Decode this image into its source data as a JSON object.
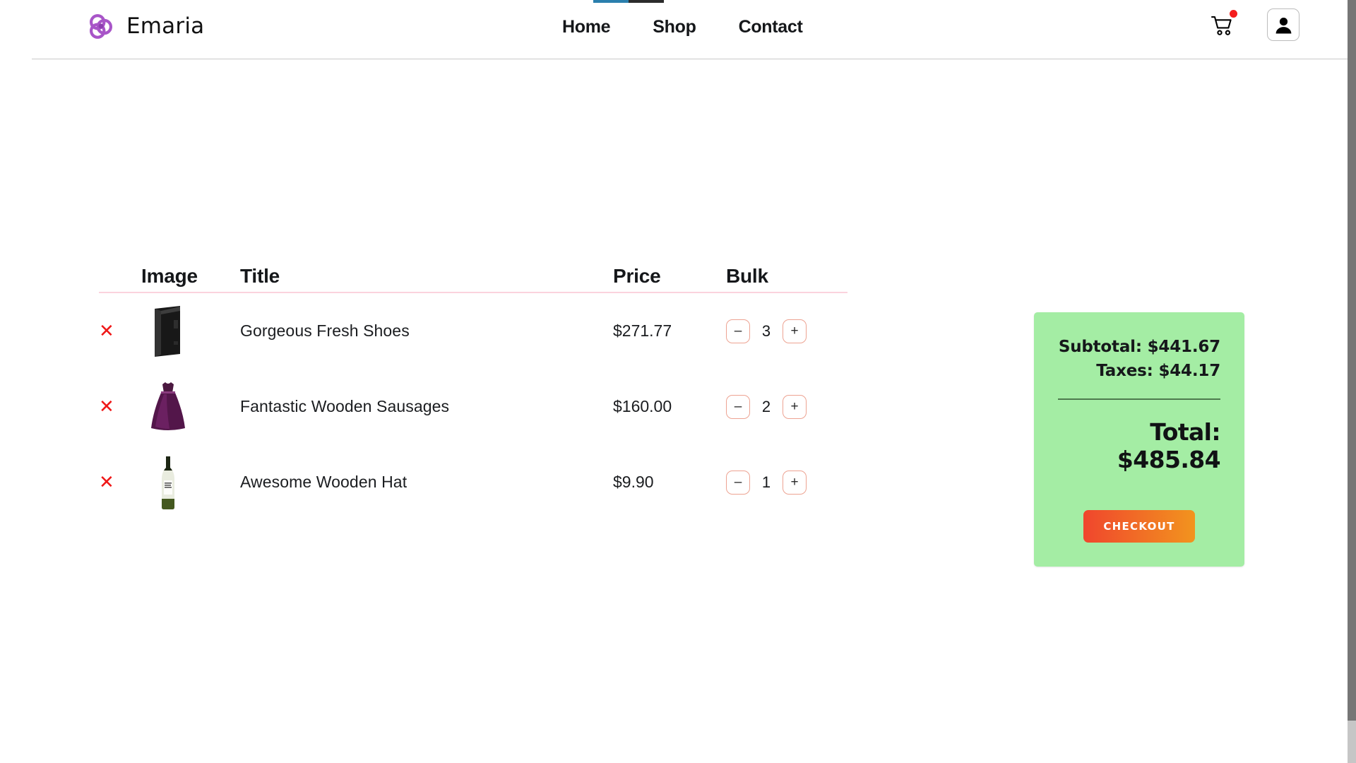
{
  "brand": {
    "name": "Emaria",
    "logo_icon": "emaria-knot-logo"
  },
  "nav": {
    "links": [
      {
        "label": "Home"
      },
      {
        "label": "Shop"
      },
      {
        "label": "Contact"
      }
    ],
    "cart_icon": "shopping-cart-icon",
    "cart_badge": "",
    "account_icon": "user-account-icon"
  },
  "loading_bar": {
    "blue_color": "#2a7fad",
    "dark_color": "#2b2b2b"
  },
  "cart": {
    "columns": [
      "Image",
      "Title",
      "Price",
      "Bulk"
    ],
    "remove_icon": "✕",
    "decrement_label": "–",
    "increment_label": "+",
    "items": [
      {
        "title": "Gorgeous Fresh Shoes",
        "price": "$271.77",
        "qty": "3",
        "image_icon": "computer-tower-thumbnail"
      },
      {
        "title": "Fantastic Wooden Sausages",
        "price": "$160.00",
        "qty": "2",
        "image_icon": "purple-dress-thumbnail"
      },
      {
        "title": "Awesome Wooden Hat",
        "price": "$9.90",
        "qty": "1",
        "image_icon": "wine-bottle-thumbnail"
      }
    ]
  },
  "summary": {
    "subtotal": "Subtotal: $441.67",
    "taxes": "Taxes: $44.17",
    "total": "Total: $485.84",
    "checkout_label": "CHECKOUT",
    "panel_color": "#a4eda4",
    "checkout_gradient_from": "#f0462d",
    "checkout_gradient_to": "#f2941e"
  }
}
